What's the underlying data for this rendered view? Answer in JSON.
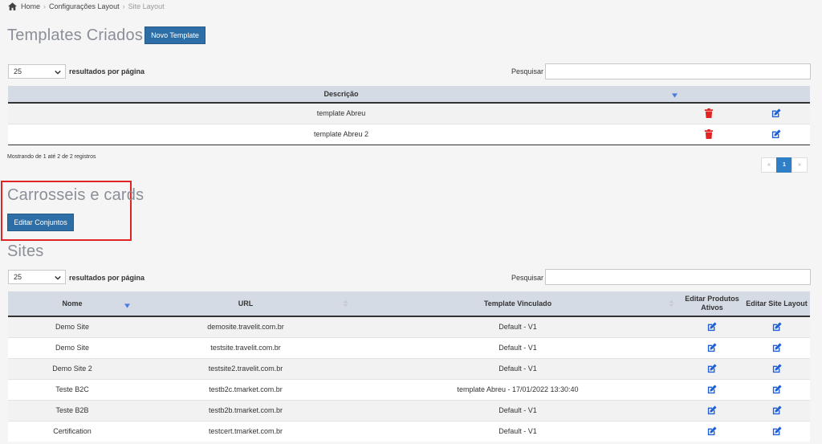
{
  "breadcrumb": {
    "home": "Home",
    "section": "Configurações Layout",
    "current": "Site Layout"
  },
  "templates": {
    "title": "Templates Criados",
    "new_button": "Novo Template",
    "page_length": "25",
    "length_label": "resultados por página",
    "search_label": "Pesquisar",
    "column_description": "Descrição",
    "rows": [
      {
        "descricao": "template Abreu"
      },
      {
        "descricao": "template Abreu 2"
      }
    ],
    "info": "Mostrando de 1 até 2 de 2 registros",
    "pagination": {
      "prev": "«",
      "page": "1",
      "next": "»"
    }
  },
  "carrosseis": {
    "title": "Carrosseis e cards",
    "edit_button": "Editar Conjuntos"
  },
  "sites": {
    "title": "Sites",
    "page_length": "25",
    "length_label": "resultados por página",
    "search_label": "Pesquisar",
    "columns": {
      "nome": "Nome",
      "url": "URL",
      "template": "Template Vinculado",
      "produtos_line1": "Editar Produtos",
      "produtos_line2": "Ativos",
      "layout": "Editar Site Layout"
    },
    "rows": [
      {
        "nome": "Demo Site",
        "url": "demosite.travelit.com.br",
        "template": "Default - V1"
      },
      {
        "nome": "Demo Site",
        "url": "testsite.travelit.com.br",
        "template": "Default - V1"
      },
      {
        "nome": "Demo Site 2",
        "url": "testsite2.travelit.com.br",
        "template": "Default - V1"
      },
      {
        "nome": "Teste B2C",
        "url": "testb2c.tmarket.com.br",
        "template": "template Abreu - 17/01/2022 13:30:40"
      },
      {
        "nome": "Teste B2B",
        "url": "testb2b.tmarket.com.br",
        "template": "Default - V1"
      },
      {
        "nome": "Certification",
        "url": "testcert.tmarket.com.br",
        "template": "Default - V1"
      }
    ]
  },
  "colors": {
    "primary": "#2e6ea6",
    "delete": "#e02424",
    "edit": "#1f5fd6",
    "header_bg": "#d5dbe5",
    "highlight": "#e02424"
  },
  "icons": {
    "home": "home-icon",
    "delete": "trash-icon",
    "edit": "edit-icon",
    "sort": "sort-arrow-icon",
    "select": "chevron-down-icon"
  }
}
